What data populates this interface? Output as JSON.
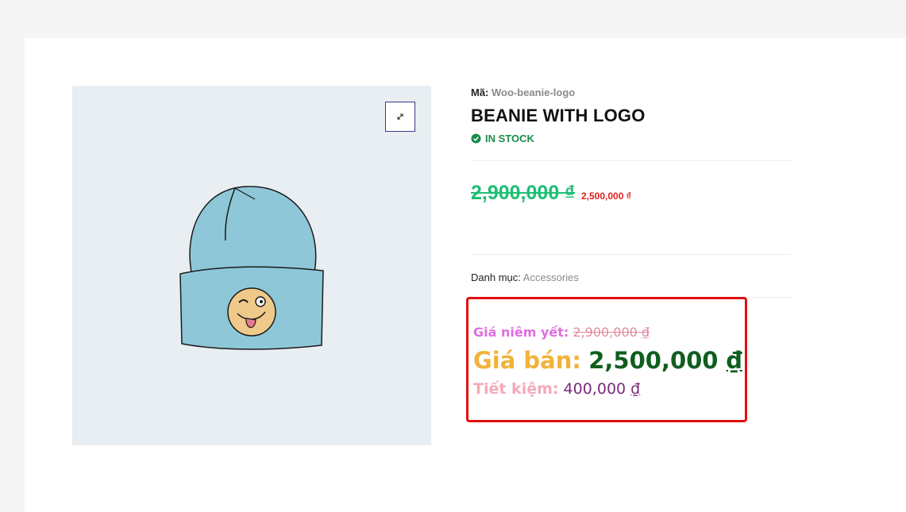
{
  "product": {
    "sku_label": "Mã:",
    "sku_value": "Woo-beanie-logo",
    "title": "BEANIE WITH LOGO",
    "stock_status": "IN STOCK",
    "price_regular": "2,900,000 ₫",
    "price_sale": "2,500,000 ₫",
    "category_label": "Danh mục:",
    "category_value": "Accessories"
  },
  "promo": {
    "listed_label": "Giá niêm yết:",
    "listed_value": "2,900,000",
    "sale_label": "Giá bán:",
    "sale_value": "2,500,000",
    "save_label": "Tiết kiệm:",
    "save_value": "400,000",
    "currency": "₫"
  },
  "colors": {
    "stock_green": "#1d8a4a",
    "regular_price_green": "#1dbf73",
    "sale_price_red": "#e02020",
    "highlight_border_red": "#e01010"
  },
  "icons": {
    "zoom": "expand-icon",
    "stock": "check-circle-icon"
  }
}
